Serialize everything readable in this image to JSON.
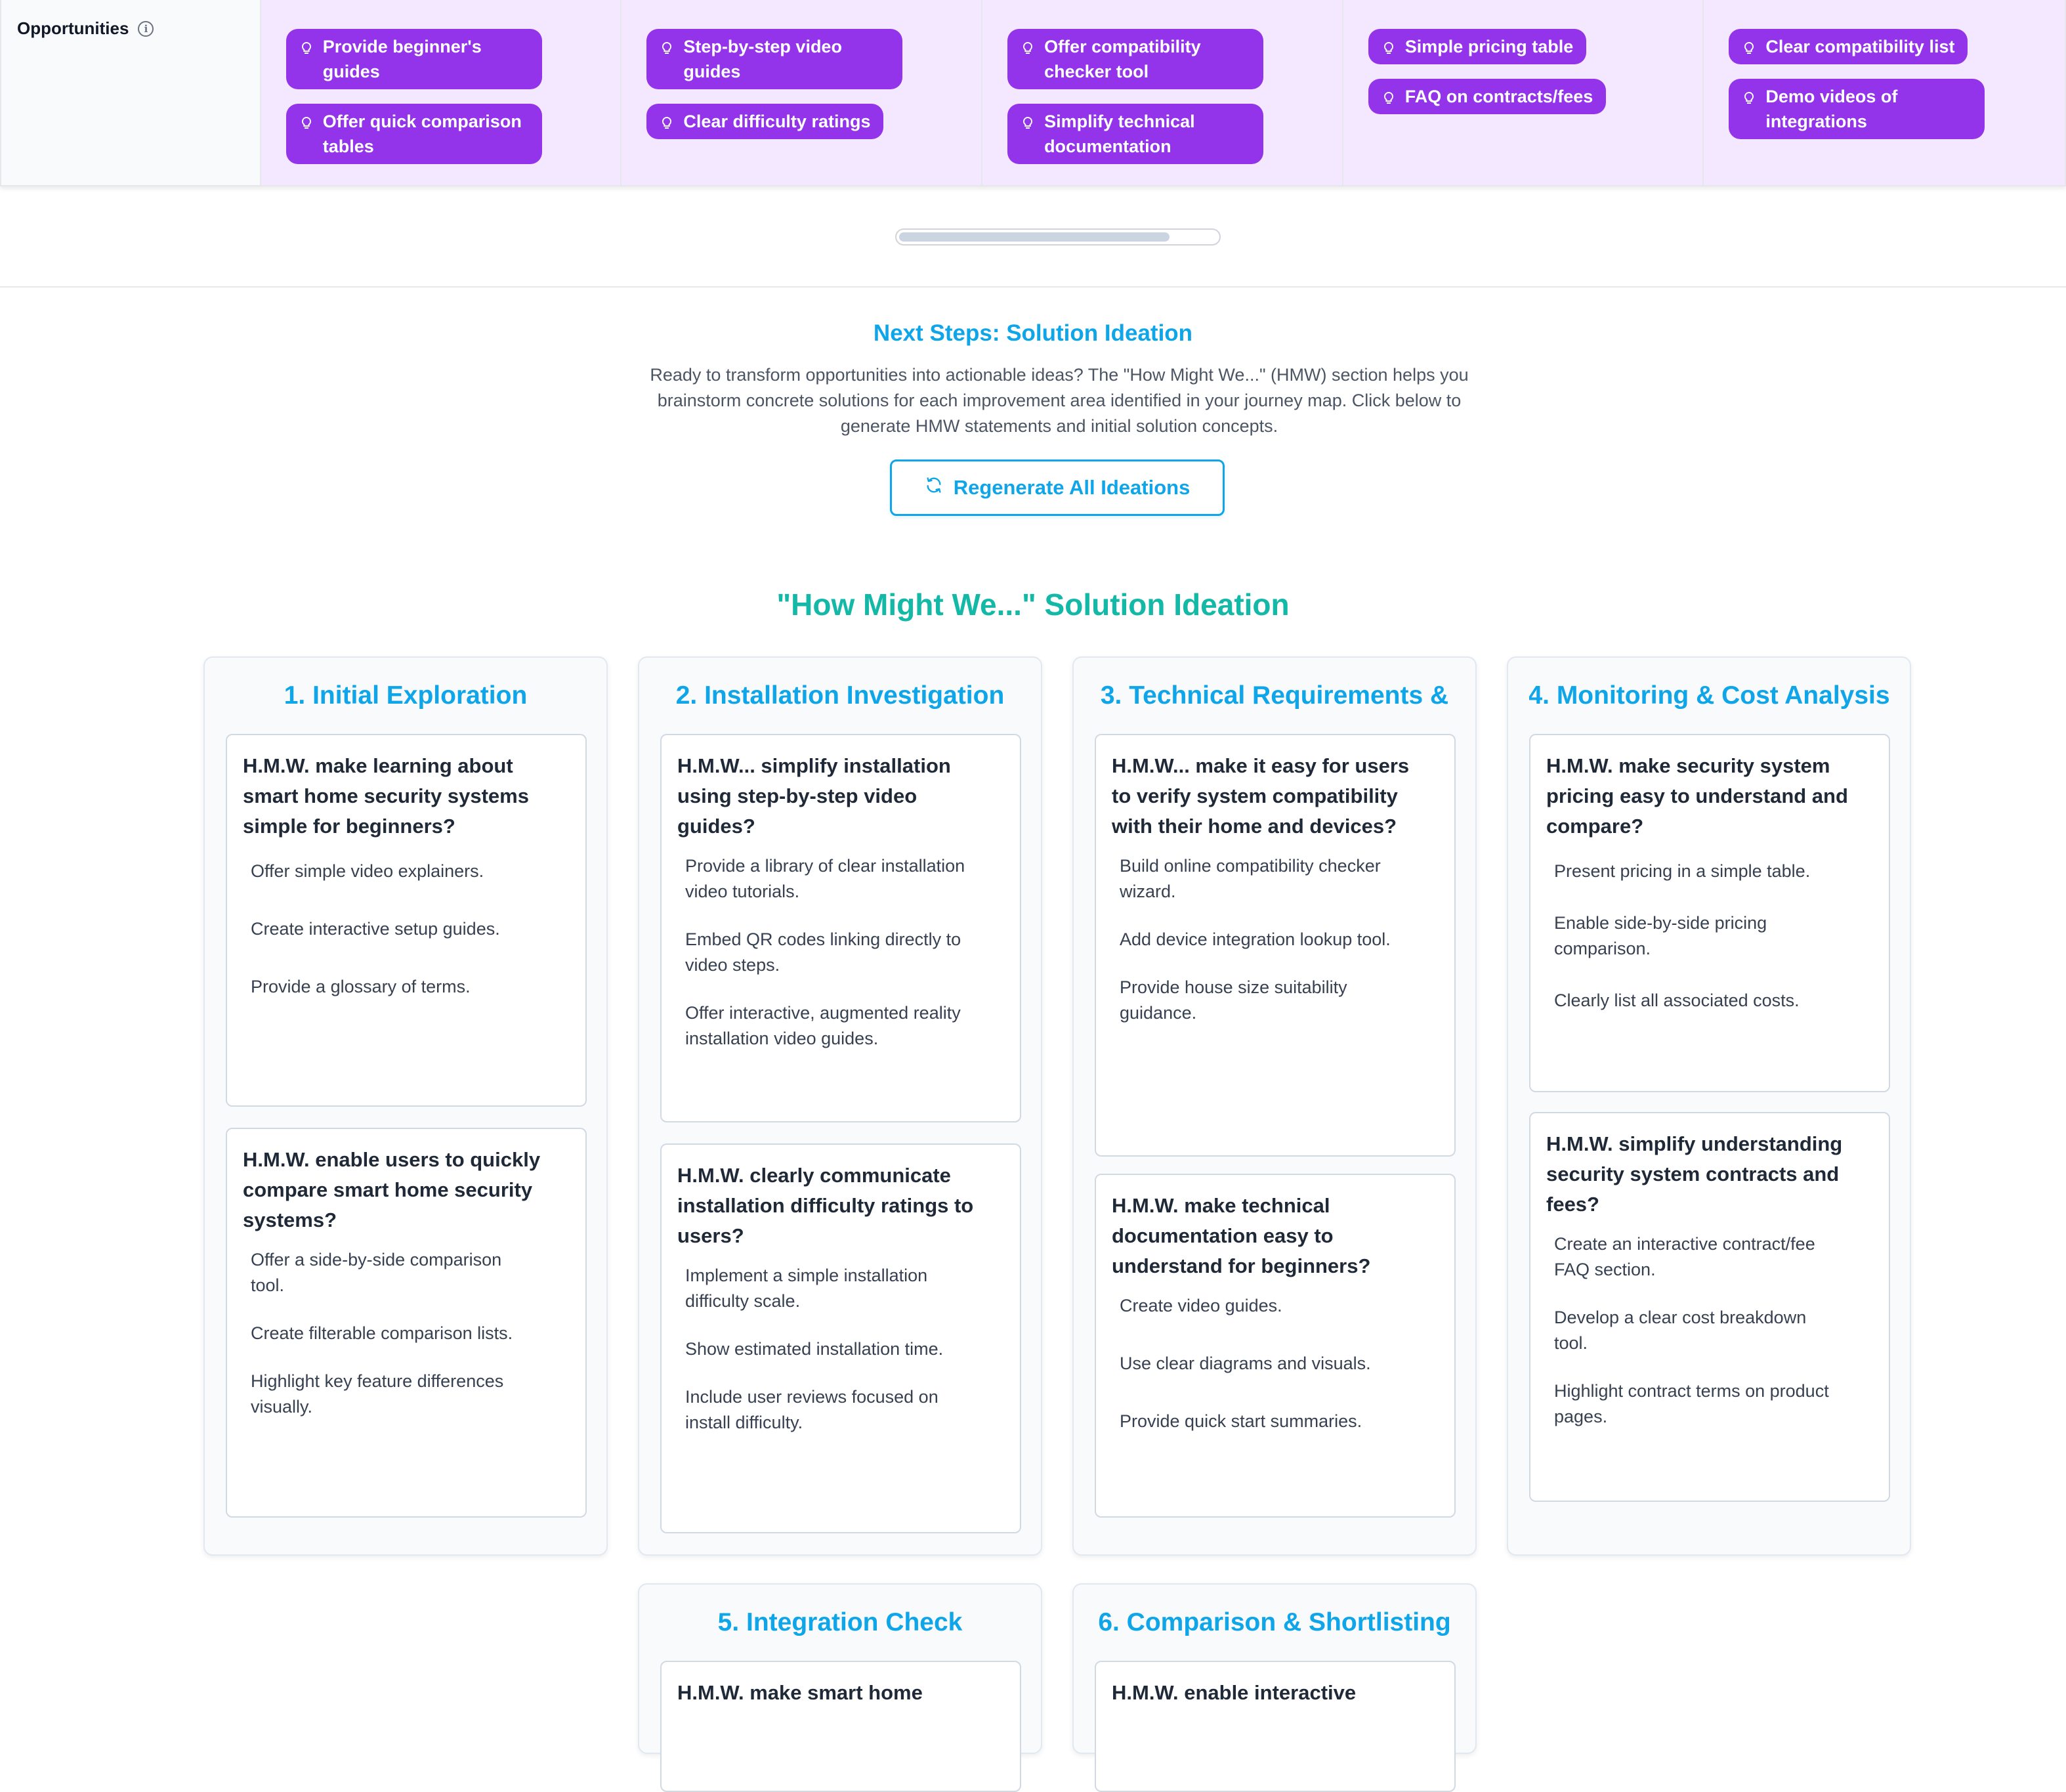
{
  "opportunities": {
    "label": "Opportunities",
    "info_icon": "info-icon",
    "columns": [
      {
        "chips": [
          "Provide beginner's guides",
          "Offer quick comparison tables"
        ]
      },
      {
        "chips": [
          "Step-by-step video guides",
          "Clear difficulty ratings"
        ]
      },
      {
        "chips": [
          "Offer compatibility checker tool",
          "Simplify technical documentation"
        ]
      },
      {
        "chips": [
          "Simple pricing table",
          "FAQ on contracts/fees"
        ]
      },
      {
        "chips": [
          "Clear compatibility list",
          "Demo videos of integrations"
        ]
      }
    ],
    "chip_icon": "lightbulb-icon",
    "chip_color": "#9333ea",
    "cell_bg": "#f3e8ff"
  },
  "next_steps": {
    "title": "Next Steps: Solution Ideation",
    "description": "Ready to transform opportunities into actionable ideas? The \"How Might We...\" (HMW) section helps you brainstorm concrete solutions for each improvement area identified in your journey map. Click below to generate HMW statements and initial solution concepts.",
    "button_label": "Regenerate All Ideations",
    "button_icon": "refresh-icon",
    "accent": "#0ea5e9"
  },
  "hmw_section": {
    "title": "\"How Might We...\" Solution Ideation",
    "title_color": "#14b8a6",
    "stages": [
      {
        "title": "1. Initial Exploration",
        "cards": [
          {
            "question": "H.M.W. make learning about smart home security systems simple for beginners?",
            "ideas": [
              "Offer simple video explainers.",
              "Create interactive setup guides.",
              "Provide a glossary of terms."
            ]
          },
          {
            "question": "H.M.W. enable users to quickly compare smart home security systems?",
            "ideas": [
              "Offer a side-by-side comparison tool.",
              "Create filterable comparison lists.",
              "Highlight key feature differences visually."
            ]
          }
        ]
      },
      {
        "title": "2. Installation Investigation",
        "cards": [
          {
            "question": "H.M.W... simplify installation using step-by-step video guides?",
            "ideas": [
              "Provide a library of clear installation video tutorials.",
              "Embed QR codes linking directly to video steps.",
              "Offer interactive, augmented reality installation video guides."
            ]
          },
          {
            "question": "H.M.W. clearly communicate installation difficulty ratings to users?",
            "ideas": [
              "Implement a simple installation difficulty scale.",
              "Show estimated installation time.",
              "Include user reviews focused on install difficulty."
            ]
          }
        ]
      },
      {
        "title": "3. Technical Requirements &",
        "cards": [
          {
            "question": "H.M.W... make it easy for users to verify system compatibility with their home and devices?",
            "ideas": [
              "Build online compatibility checker wizard.",
              "Add device integration lookup tool.",
              "Provide house size suitability guidance."
            ]
          },
          {
            "question": "H.M.W. make technical documentation easy to understand for beginners?",
            "ideas": [
              "Create video guides.",
              "Use clear diagrams and visuals.",
              "Provide quick start summaries."
            ]
          }
        ]
      },
      {
        "title": "4. Monitoring & Cost Analysis",
        "cards": [
          {
            "question": "H.M.W. make security system pricing easy to understand and compare?",
            "ideas": [
              "Present pricing in a simple table.",
              "Enable side-by-side pricing comparison.",
              "Clearly list all associated costs."
            ]
          },
          {
            "question": "H.M.W. simplify understanding security system contracts and fees?",
            "ideas": [
              "Create an interactive contract/fee FAQ section.",
              "Develop a clear cost breakdown tool.",
              "Highlight contract terms on product pages."
            ]
          }
        ]
      },
      {
        "title": "5. Integration Check",
        "cards": [
          {
            "question": "H.M.W. make smart home",
            "ideas": []
          }
        ]
      },
      {
        "title": "6. Comparison & Shortlisting",
        "cards": [
          {
            "question": "H.M.W. enable interactive",
            "ideas": []
          }
        ]
      }
    ]
  }
}
